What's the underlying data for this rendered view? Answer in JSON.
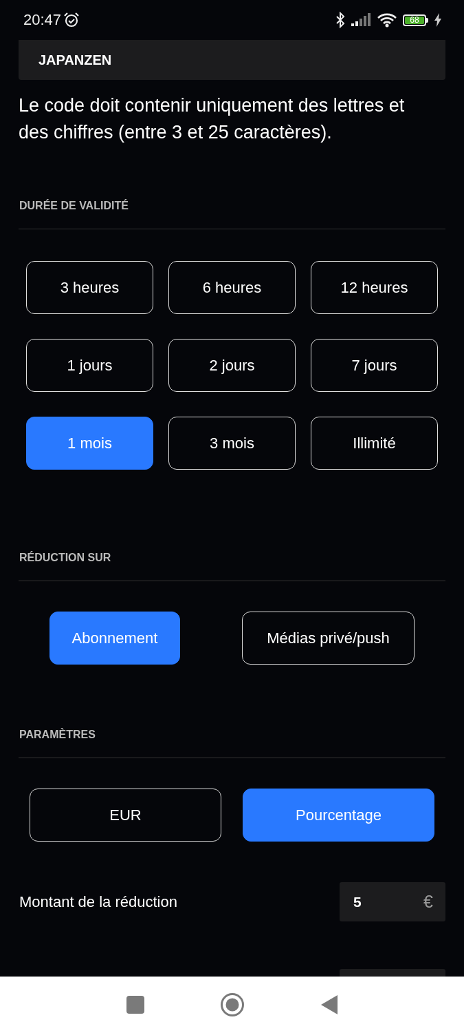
{
  "status_bar": {
    "time": "20:47",
    "battery": "68"
  },
  "code_field": {
    "value": "JAPANZEN"
  },
  "hint": "Le code doit contenir uniquement des lettres et des chiffres (entre 3 et 25 caractères).",
  "sections": [
    {
      "title": "DURÉE DE VALIDITÉ",
      "kind": "grid",
      "options": [
        {
          "label": "3 heures",
          "selected": false
        },
        {
          "label": "6 heures",
          "selected": false
        },
        {
          "label": "12 heures",
          "selected": false
        },
        {
          "label": "1 jours",
          "selected": false
        },
        {
          "label": "2 jours",
          "selected": false
        },
        {
          "label": "7 jours",
          "selected": false
        },
        {
          "label": "1 mois",
          "selected": true
        },
        {
          "label": "3 mois",
          "selected": false
        },
        {
          "label": "Illimité",
          "selected": false
        }
      ]
    },
    {
      "title": "RÉDUCTION SUR",
      "kind": "pair",
      "options": [
        {
          "label": "Abonnement",
          "selected": true
        },
        {
          "label": "Médias privé/push",
          "selected": false
        }
      ]
    },
    {
      "title": "PARAMÈTRES",
      "kind": "wide",
      "options": [
        {
          "label": "EUR",
          "selected": false
        },
        {
          "label": "Pourcentage",
          "selected": true
        }
      ]
    }
  ],
  "amount": {
    "label": "Montant de la réduction",
    "value": "5",
    "suffix": "€"
  }
}
